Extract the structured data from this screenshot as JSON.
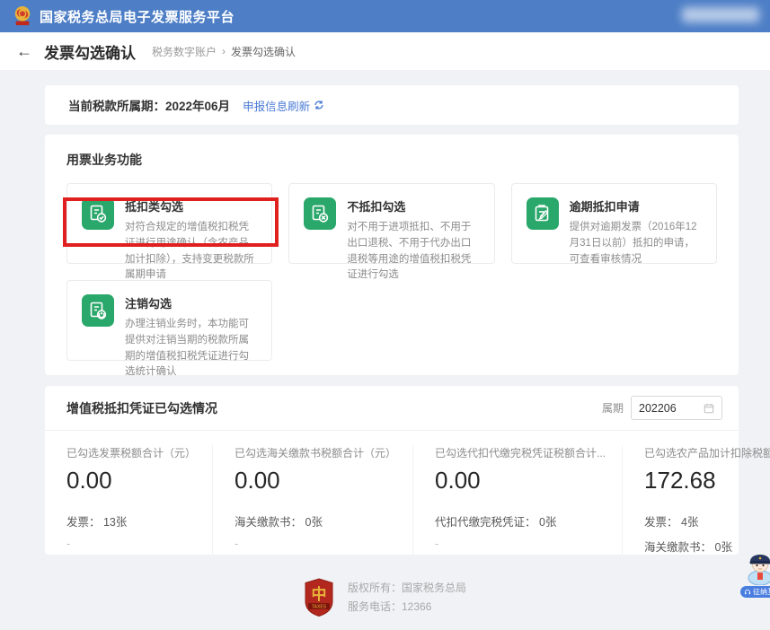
{
  "header": {
    "title": "国家税务总局电子发票服务平台"
  },
  "breadcrumb": {
    "page_title": "发票勾选确认",
    "trail_root": "税务数字账户",
    "separator": "›",
    "trail_current": "发票勾选确认"
  },
  "period_card": {
    "label": "当前税款所属期：",
    "value": "2022年06月",
    "refresh_link": "申报信息刷新"
  },
  "functions_panel": {
    "title": "用票业务功能",
    "cards": [
      {
        "title": "抵扣类勾选",
        "desc": "对符合规定的增值税扣税凭证进行用途确认（含农产品加计扣除），支持变更税款所属期申请",
        "icon": "doc-check-icon",
        "highlighted": true
      },
      {
        "title": "不抵扣勾选",
        "desc": "对不用于进项抵扣、不用于出口退税、不用于代办出口退税等用途的增值税扣税凭证进行勾选",
        "icon": "doc-cross-icon",
        "highlighted": false
      },
      {
        "title": "逾期抵扣申请",
        "desc": "提供对逾期发票（2016年12月31日以前）抵扣的申请，可查看审核情况",
        "icon": "doc-apply-icon",
        "highlighted": false
      },
      {
        "title": "注销勾选",
        "desc": "办理注销业务时，本功能可提供对注销当期的税款所属期的增值税扣税凭证进行勾选统计确认",
        "icon": "doc-power-icon",
        "highlighted": false
      }
    ]
  },
  "summary_panel": {
    "title": "增值税抵扣凭证已勾选情况",
    "period_label": "属期",
    "period_value": "202206",
    "stats": [
      {
        "label": "已勾选发票税额合计（元）",
        "value": "0.00",
        "line1": "发票： 13张",
        "line2": "-"
      },
      {
        "label": "已勾选海关缴款书税额合计（元）",
        "value": "0.00",
        "line1": "海关缴款书： 0张",
        "line2": "-"
      },
      {
        "label": "已勾选代扣代缴完税凭证税额合计...",
        "value": "0.00",
        "line1": "代扣代缴完税凭证： 0张",
        "line2": "-"
      },
      {
        "label": "已勾选农产品加计扣除税额合计（...",
        "value": "172.68",
        "line1": "发票： 4张",
        "line2": "海关缴款书： 0张"
      }
    ]
  },
  "footer": {
    "copyright": "版权所有：国家税务总局",
    "phone": "服务电话：12366"
  },
  "mascot": {
    "label": "征纳互动"
  },
  "colors": {
    "header_blue": "#4d7ec6",
    "link_blue": "#4b7bd5",
    "icon_green": "#2aa76b",
    "highlight_red": "#e01f1f"
  }
}
